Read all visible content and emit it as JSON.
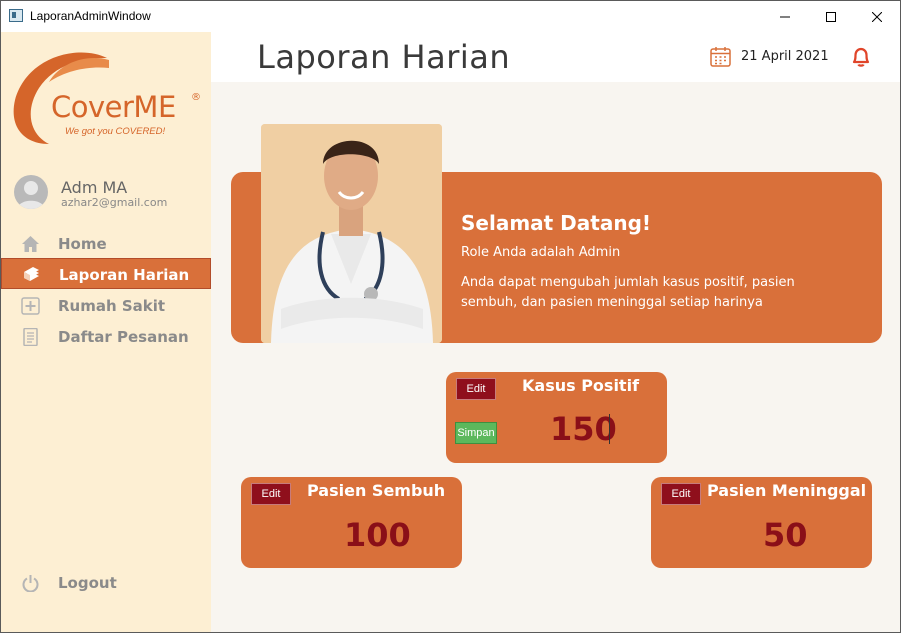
{
  "window": {
    "title": "LaporanAdminWindow",
    "controls": [
      "minimize-icon",
      "maximize-icon",
      "close-icon"
    ]
  },
  "sidebar": {
    "logo": {
      "brand": "CoverME",
      "registered": "®",
      "tagline": "We got you COVERED!"
    },
    "user": {
      "name": "Adm MA",
      "email": "azhar2@gmail.com"
    },
    "items": [
      {
        "label": "Home",
        "icon": "home-icon",
        "active": false
      },
      {
        "label": "Laporan Harian",
        "icon": "report-book-icon",
        "active": true
      },
      {
        "label": "Rumah Sakit",
        "icon": "hospital-plus-icon",
        "active": false
      },
      {
        "label": "Daftar Pesanan",
        "icon": "order-list-icon",
        "active": false
      }
    ],
    "logout": {
      "label": "Logout",
      "icon": "power-icon"
    }
  },
  "header": {
    "title": "Laporan Harian",
    "date": "21 April 2021",
    "date_icon": "calendar-icon",
    "notification_icon": "bell-icon"
  },
  "banner": {
    "title": "Selamat Datang!",
    "role": "Role Anda adalah Admin",
    "description": "Anda dapat mengubah jumlah kasus positif, pasien sembuh, dan pasien meninggal setiap harinya"
  },
  "stats": {
    "positif": {
      "title": "Kasus Positif",
      "value": "150",
      "edit_label": "Edit",
      "save_label": "Simpan"
    },
    "sembuh": {
      "title": "Pasien Sembuh",
      "value": "100",
      "edit_label": "Edit"
    },
    "meninggal": {
      "title": "Pasien Meninggal",
      "value": "50",
      "edit_label": "Edit"
    }
  },
  "colors": {
    "accent": "#d9703a",
    "sidebar_bg": "#fdefd3",
    "value_text": "#8a0f18",
    "edit_button": "#8f0f1c",
    "save_button": "#5cb85c",
    "main_bg": "#f8f5f0"
  }
}
